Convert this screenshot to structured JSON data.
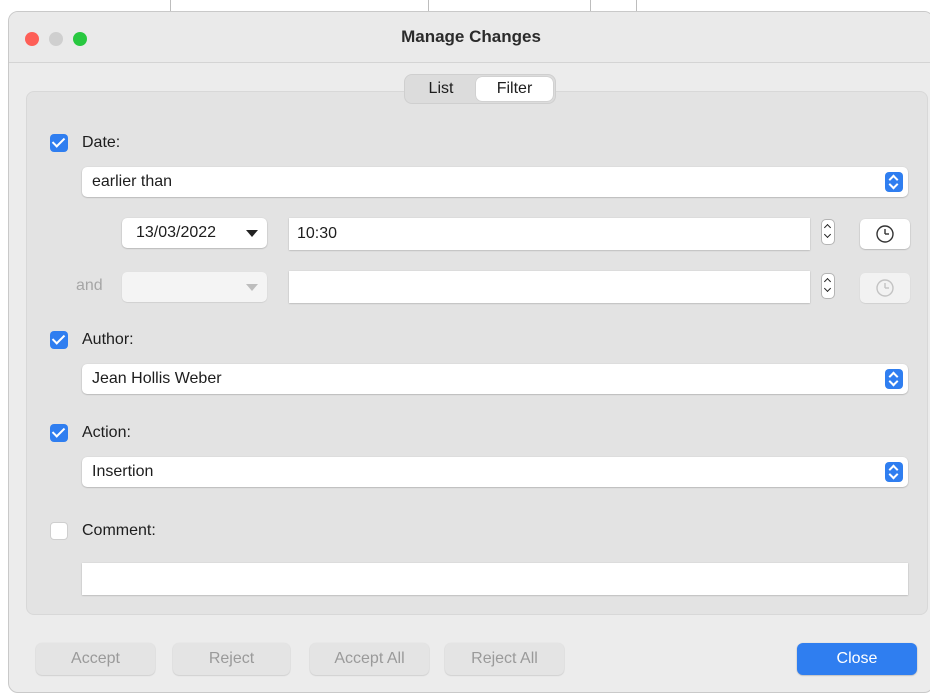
{
  "window": {
    "title": "Manage Changes"
  },
  "traffic_lights": {
    "close_color": "#fe5f57",
    "minimize_color": "#cfcfcf",
    "zoom_color": "#28c840"
  },
  "tabs": [
    {
      "label": "List",
      "selected": false
    },
    {
      "label": "Filter",
      "selected": true
    }
  ],
  "filter": {
    "date": {
      "label": "Date:",
      "checked": true,
      "condition": "earlier than",
      "date_value": "13/03/2022",
      "time_value": "10:30",
      "and_label": "and",
      "second_date_value": "",
      "second_time_value": ""
    },
    "author": {
      "label": "Author:",
      "checked": true,
      "value": "Jean Hollis Weber"
    },
    "action": {
      "label": "Action:",
      "checked": true,
      "value": "Insertion"
    },
    "comment": {
      "label": "Comment:",
      "checked": false,
      "value": ""
    }
  },
  "buttons": {
    "accept": "Accept",
    "reject": "Reject",
    "accept_all": "Accept All",
    "reject_all": "Reject All",
    "close": "Close"
  },
  "colors": {
    "accent": "#2f7ef0"
  }
}
